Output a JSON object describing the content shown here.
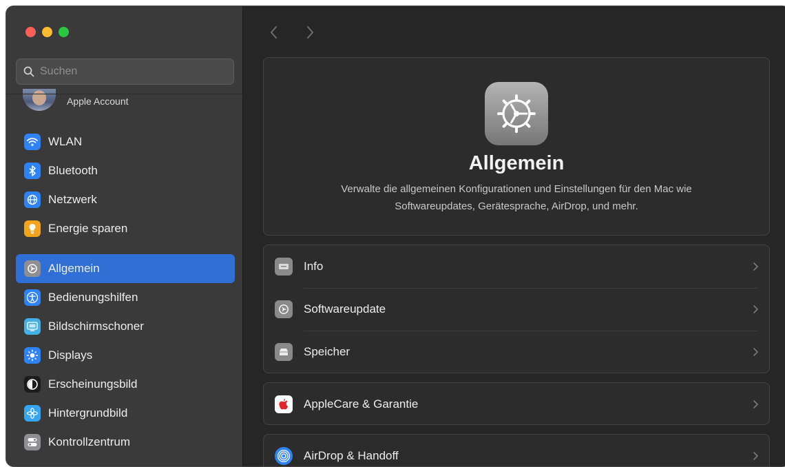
{
  "sidebar": {
    "search_placeholder": "Suchen",
    "account_label": "Apple Account",
    "items": [
      {
        "label": "WLAN",
        "icon": "wifi-icon",
        "color": "#2f83f7"
      },
      {
        "label": "Bluetooth",
        "icon": "bluetooth-icon",
        "color": "#2f83f7"
      },
      {
        "label": "Netzwerk",
        "icon": "globe-icon",
        "color": "#2f83f7"
      },
      {
        "label": "Energie sparen",
        "icon": "lightbulb-icon",
        "color": "#f2a51c"
      },
      {
        "label": "Allgemein",
        "icon": "gear-icon",
        "color": "#8e8e93",
        "active": true
      },
      {
        "label": "Bedienungshilfen",
        "icon": "accessibility-icon",
        "color": "#2f83f7"
      },
      {
        "label": "Bildschirmschoner",
        "icon": "screensaver-icon",
        "color": "#45b0e6"
      },
      {
        "label": "Displays",
        "icon": "sun-icon",
        "color": "#2f83f7"
      },
      {
        "label": "Erscheinungsbild",
        "icon": "appearance-icon",
        "color": "#1c1c1e"
      },
      {
        "label": "Hintergrundbild",
        "icon": "flower-icon",
        "color": "#37a6f0"
      },
      {
        "label": "Kontrollzentrum",
        "icon": "toggles-icon",
        "color": "#8e8e93"
      }
    ]
  },
  "hero": {
    "title": "Allgemein",
    "description": "Verwalte die allgemeinen Konfigurationen und Einstellungen für den Mac wie Softwareupdates, Gerätesprache, AirDrop, und mehr."
  },
  "rows": [
    {
      "label": "Info",
      "icon": "info-laptop-icon"
    },
    {
      "label": "Softwareupdate",
      "icon": "software-update-icon"
    },
    {
      "label": "Speicher",
      "icon": "storage-drive-icon"
    },
    {
      "label": "AppleCare & Garantie",
      "icon": "apple-logo-icon"
    },
    {
      "label": "AirDrop & Handoff",
      "icon": "airdrop-icon"
    }
  ]
}
